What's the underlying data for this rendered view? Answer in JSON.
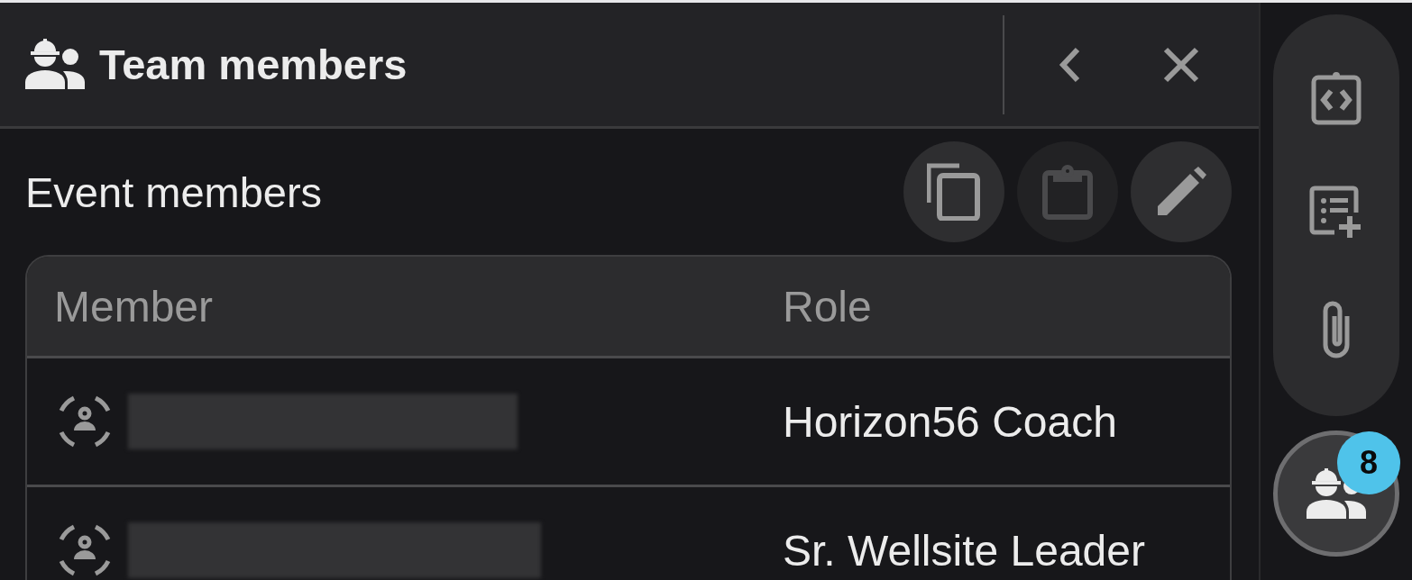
{
  "panel": {
    "title": "Team members"
  },
  "section": {
    "title": "Event members",
    "actions": [
      {
        "kind": "copy",
        "disabled": false
      },
      {
        "kind": "paste",
        "disabled": true
      },
      {
        "kind": "edit",
        "disabled": false
      }
    ]
  },
  "table": {
    "columns": [
      "Member",
      "Role"
    ],
    "rows": [
      {
        "role": "Horizon56 Coach"
      },
      {
        "role": "Sr. Wellsite Leader"
      }
    ]
  },
  "rail": {
    "items": [
      {
        "kind": "clipboard-code"
      },
      {
        "kind": "list-add"
      },
      {
        "kind": "attachment"
      }
    ],
    "team_button": {
      "badge": "8"
    }
  }
}
